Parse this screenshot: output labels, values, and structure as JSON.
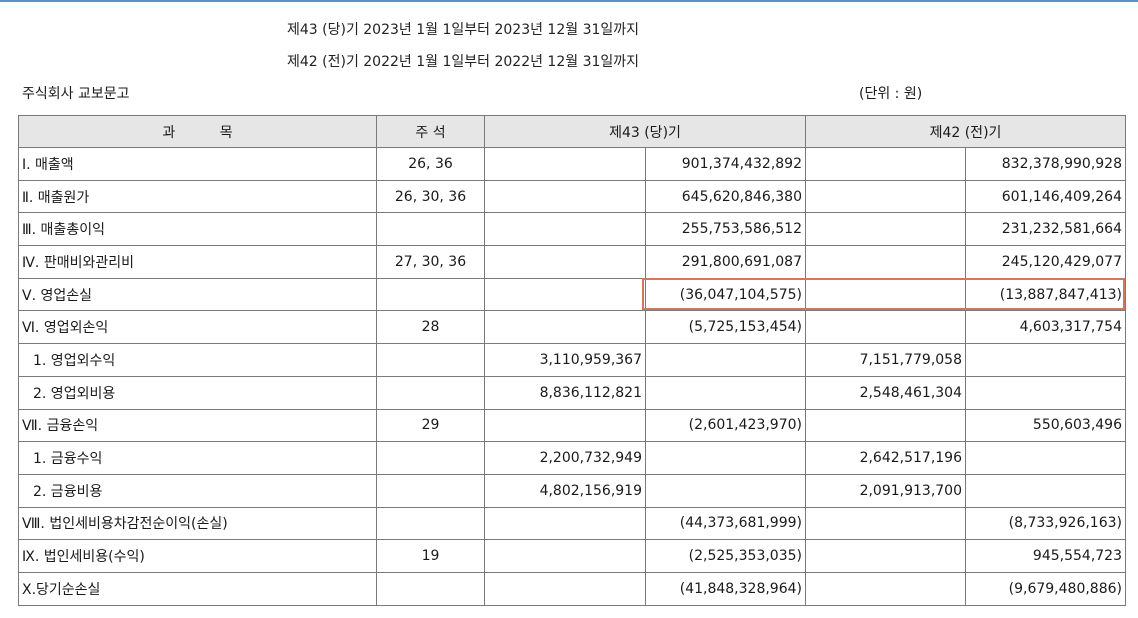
{
  "header": {
    "period_current": "제43 (당)기 2023년 1월 1일부터 2023년 12월 31일까지",
    "period_prior": "제42 (전)기 2022년 1월 1일부터 2022년 12월 31일까지",
    "company": "주식회사 교보문고",
    "unit": "(단위 : 원)"
  },
  "table": {
    "columns": {
      "item": "과          목",
      "note": "주 석",
      "current": "제43 (당)기",
      "prior": "제42 (전)기"
    },
    "rows": [
      {
        "item": "Ⅰ. 매출액",
        "note": "26, 36",
        "cur_sub": "",
        "cur_total": "901,374,432,892",
        "prior_sub": "",
        "prior_total": "832,378,990,928"
      },
      {
        "item": "Ⅱ. 매출원가",
        "note": "26, 30, 36",
        "cur_sub": "",
        "cur_total": "645,620,846,380",
        "prior_sub": "",
        "prior_total": "601,146,409,264"
      },
      {
        "item": "Ⅲ. 매출총이익",
        "note": "",
        "cur_sub": "",
        "cur_total": "255,753,586,512",
        "prior_sub": "",
        "prior_total": "231,232,581,664"
      },
      {
        "item": "Ⅳ. 판매비와관리비",
        "note": "27, 30, 36",
        "cur_sub": "",
        "cur_total": "291,800,691,087",
        "prior_sub": "",
        "prior_total": "245,120,429,077"
      },
      {
        "item": "Ⅴ. 영업손실",
        "note": "",
        "cur_sub": "",
        "cur_total": "(36,047,104,575)",
        "prior_sub": "",
        "prior_total": "(13,887,847,413)"
      },
      {
        "item": "Ⅵ. 영업외손익",
        "note": "28",
        "cur_sub": "",
        "cur_total": "(5,725,153,454)",
        "prior_sub": "",
        "prior_total": "4,603,317,754"
      },
      {
        "item": "1. 영업외수익",
        "note": "",
        "cur_sub": "3,110,959,367",
        "cur_total": "",
        "prior_sub": "7,151,779,058",
        "prior_total": ""
      },
      {
        "item": "2. 영업외비용",
        "note": "",
        "cur_sub": "8,836,112,821",
        "cur_total": "",
        "prior_sub": "2,548,461,304",
        "prior_total": ""
      },
      {
        "item": "Ⅶ. 금융손익",
        "note": "29",
        "cur_sub": "",
        "cur_total": "(2,601,423,970)",
        "prior_sub": "",
        "prior_total": "550,603,496"
      },
      {
        "item": "1. 금융수익",
        "note": "",
        "cur_sub": "2,200,732,949",
        "cur_total": "",
        "prior_sub": "2,642,517,196",
        "prior_total": ""
      },
      {
        "item": "2. 금융비용",
        "note": "",
        "cur_sub": "4,802,156,919",
        "cur_total": "",
        "prior_sub": "2,091,913,700",
        "prior_total": ""
      },
      {
        "item": "Ⅷ. 법인세비용차감전순이익(손실)",
        "note": "",
        "cur_sub": "",
        "cur_total": "(44,373,681,999)",
        "prior_sub": "",
        "prior_total": "(8,733,926,163)"
      },
      {
        "item": "Ⅸ. 법인세비용(수익)",
        "note": "19",
        "cur_sub": "",
        "cur_total": "(2,525,353,035)",
        "prior_sub": "",
        "prior_total": "945,554,723"
      },
      {
        "item": "Ⅹ.당기순손실",
        "note": "",
        "cur_sub": "",
        "cur_total": "(41,848,328,964)",
        "prior_sub": "",
        "prior_total": "(9,679,480,886)"
      }
    ]
  },
  "highlight": {
    "row": "Ⅴ. 영업손실",
    "color": "#d2765c"
  }
}
